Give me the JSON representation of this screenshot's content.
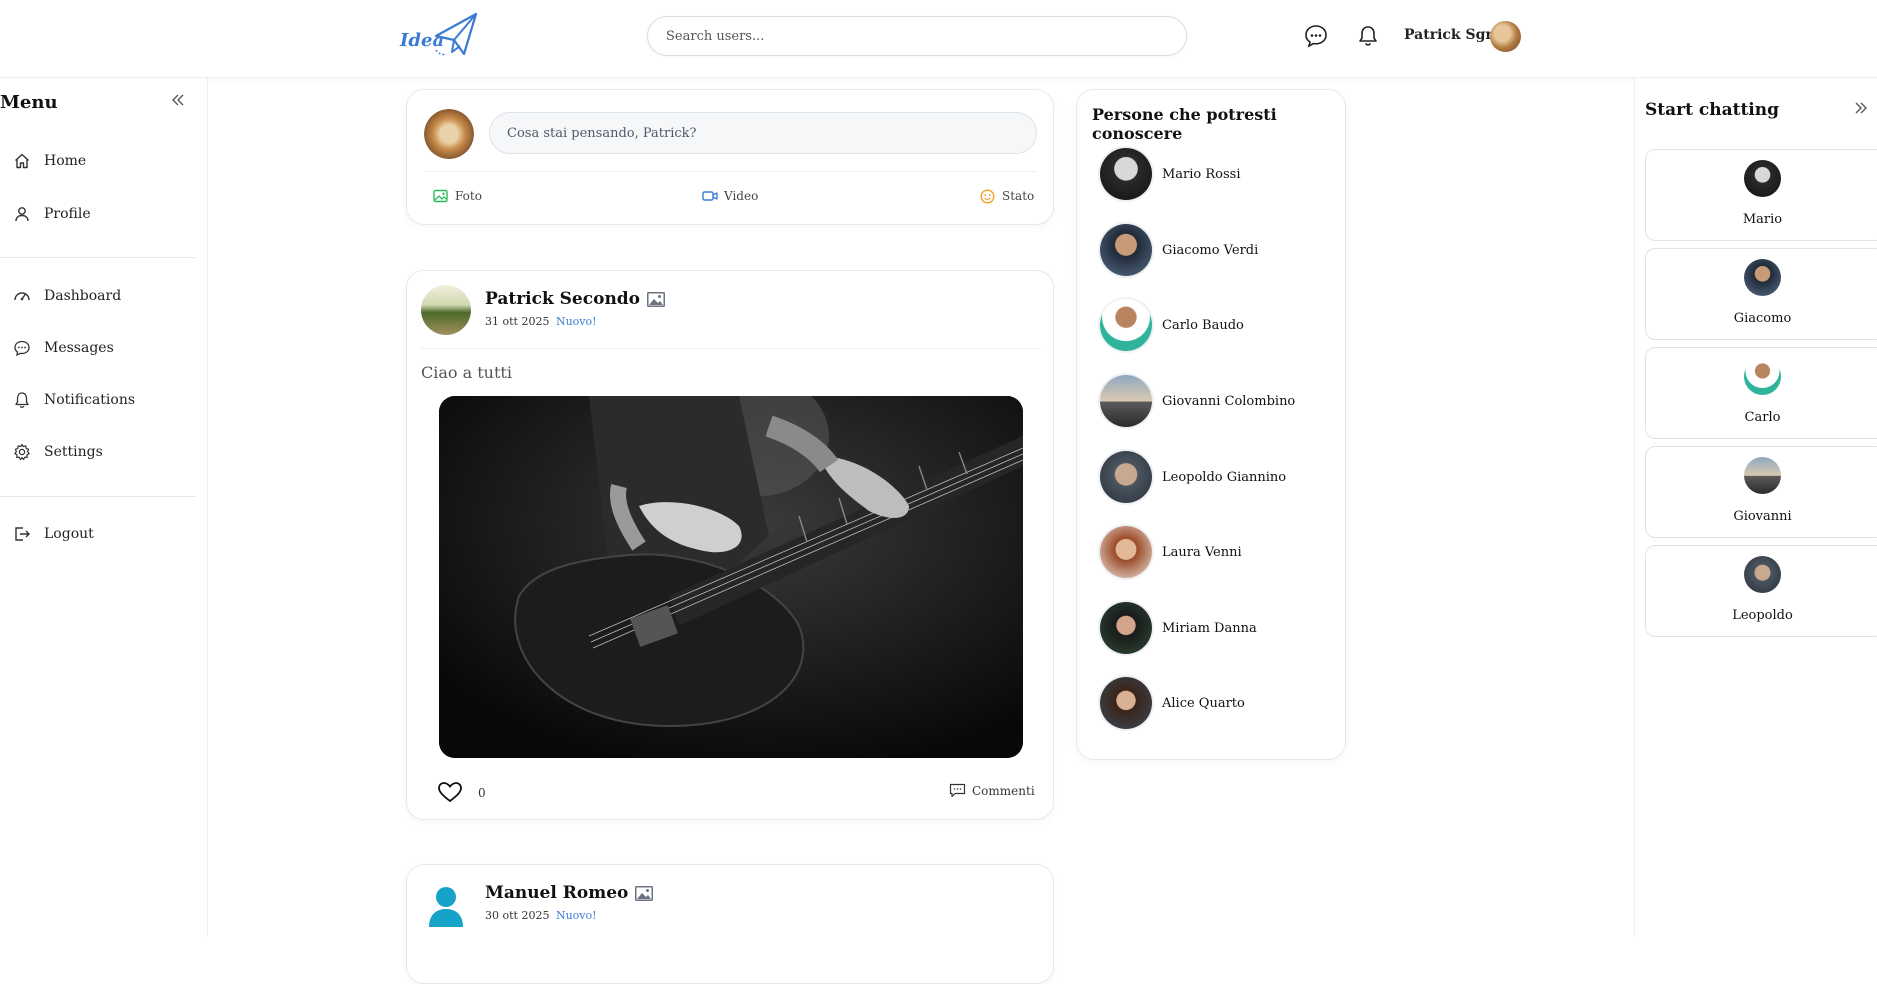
{
  "header": {
    "logo_text": "Idea",
    "search_placeholder": "Search users...",
    "icons": [
      "chat-icon",
      "bell-icon"
    ],
    "user_name": "Patrick Sgro"
  },
  "menu": {
    "title": "Menu",
    "items": [
      {
        "label": "Home",
        "icon": "home-icon"
      },
      {
        "label": "Profile",
        "icon": "user-icon"
      },
      {
        "label": "Dashboard",
        "icon": "gauge-icon"
      },
      {
        "label": "Messages",
        "icon": "message-icon"
      },
      {
        "label": "Notifications",
        "icon": "bell-icon"
      },
      {
        "label": "Settings",
        "icon": "gear-icon"
      },
      {
        "label": "Logout",
        "icon": "logout-icon"
      }
    ]
  },
  "composer": {
    "placeholder": "Cosa stai pensando, Patrick?",
    "actions": [
      {
        "label": "Foto",
        "icon": "photo-icon",
        "color": "#2eb85c"
      },
      {
        "label": "Video",
        "icon": "video-icon",
        "color": "#3a7bd5"
      },
      {
        "label": "Stato",
        "icon": "smile-icon",
        "color": "#f0a020"
      }
    ]
  },
  "posts": [
    {
      "author": "Patrick Secondo",
      "date": "31 ott 2025",
      "badge": "Nuovo!",
      "text": "Ciao a tutti",
      "likes": "0",
      "comments_label": "Commenti"
    },
    {
      "author": "Manuel Romeo",
      "date": "30 ott 2025",
      "badge": "Nuovo!"
    }
  ],
  "suggestions": {
    "title": "Persone che potresti conoscere",
    "people": [
      {
        "name": "Mario Rossi",
        "color": "#2a2a2a"
      },
      {
        "name": "Giacomo Verdi",
        "color": "#5a6e8a"
      },
      {
        "name": "Carlo Baudo",
        "color": "#2fb39a"
      },
      {
        "name": "Giovanni Colombino",
        "color": "#8a9ab0"
      },
      {
        "name": "Leopoldo Giannino",
        "color": "#4a5560"
      },
      {
        "name": "Laura Venni",
        "color": "#b0704a"
      },
      {
        "name": "Miriam Danna",
        "color": "#2e4a38"
      },
      {
        "name": "Alice Quarto",
        "color": "#3a4a5a"
      }
    ]
  },
  "chat": {
    "title": "Start chatting",
    "contacts": [
      {
        "name": "Mario",
        "color": "#2a2a2a"
      },
      {
        "name": "Giacomo",
        "color": "#5a6e8a"
      },
      {
        "name": "Carlo",
        "color": "#2fb39a"
      },
      {
        "name": "Giovanni",
        "color": "#8a9ab0"
      },
      {
        "name": "Leopoldo",
        "color": "#4a5560"
      }
    ]
  }
}
